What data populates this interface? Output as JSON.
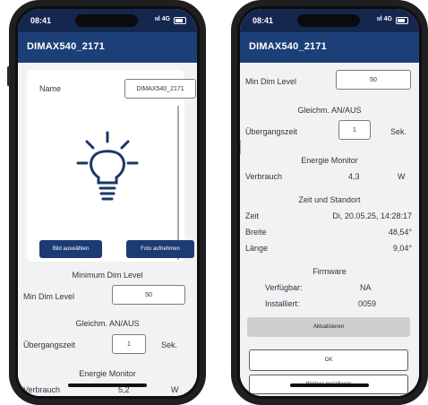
{
  "left_phone": {
    "status_time": "08:41",
    "network": "4G",
    "title": "DIMAX540_2171",
    "name_label": "Name",
    "name_value": "DIMAX540_2171",
    "btn_select_image": "Bild auswählen",
    "btn_take_photo": "Foto aufnehmen",
    "min_dim_header": "Minimum Dim Level",
    "min_dim_label": "Min Dim Level",
    "min_dim_value": "50",
    "sync_header": "Gleichm. AN/AUS",
    "transition_label": "Übergangszeit",
    "transition_value": "1",
    "transition_unit": "Sek.",
    "energy_header": "Energie Monitor",
    "consumption_label": "Verbrauch",
    "consumption_value": "5,2",
    "consumption_unit": "W"
  },
  "right_phone": {
    "status_time": "08:41",
    "network": "4G",
    "title": "DIMAX540_2171",
    "min_dim_label": "Min Dim Level",
    "min_dim_value": "50",
    "sync_header": "Gleichm. AN/AUS",
    "transition_label": "Übergangszeit",
    "transition_value": "1",
    "transition_unit": "Sek.",
    "energy_header": "Energie Monitor",
    "consumption_label": "Verbrauch",
    "consumption_value": "4,3",
    "consumption_unit": "W",
    "time_location_header": "Zeit und Standort",
    "time_label": "Zeit",
    "time_value": "Di, 20.05.25, 14:28:17",
    "lat_label": "Breite",
    "lat_value": "48,54°",
    "lon_label": "Länge",
    "lon_value": "9,04°",
    "firmware_header": "Firmware",
    "available_label": "Verfügbar:",
    "available_value": "NA",
    "installed_label": "Installiert:",
    "installed_value": "0059",
    "btn_update": "Aktualisieren",
    "btn_ok": "OK",
    "btn_more": "Weitere installieren"
  },
  "icons": {
    "bulb": "lightbulb-icon",
    "signal": "signal-icon",
    "battery": "battery-icon"
  },
  "colors": {
    "app_bar": "#1d3f78",
    "status_bar": "#14284f",
    "primary_button": "#1c3b74",
    "content_bg": "#f2f2f2"
  }
}
